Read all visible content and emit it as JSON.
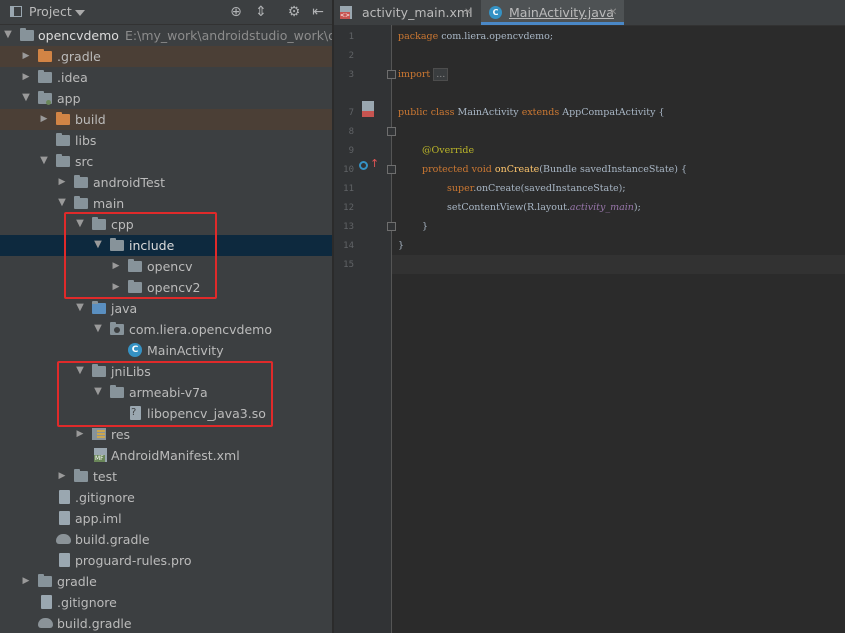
{
  "project_panel": {
    "title": "Project",
    "tree": [
      {
        "label": "opencvdemo",
        "extra": "E:\\my_work\\androidstudio_work\\op",
        "icon": "project-module-icon",
        "expanded": true
      },
      {
        "label": ".gradle",
        "icon": "folder-orange-icon",
        "expanded": false
      },
      {
        "label": ".idea",
        "icon": "folder-icon",
        "expanded": false
      },
      {
        "label": "app",
        "icon": "module-folder-icon",
        "expanded": true
      },
      {
        "label": "build",
        "icon": "folder-orange-icon",
        "expanded": false
      },
      {
        "label": "libs",
        "icon": "folder-icon"
      },
      {
        "label": "src",
        "icon": "folder-icon",
        "expanded": true
      },
      {
        "label": "androidTest",
        "icon": "folder-icon",
        "expanded": false
      },
      {
        "label": "main",
        "icon": "folder-icon",
        "expanded": true
      },
      {
        "label": "cpp",
        "icon": "folder-icon",
        "expanded": true
      },
      {
        "label": "include",
        "icon": "folder-icon",
        "expanded": true
      },
      {
        "label": "opencv",
        "icon": "folder-icon",
        "expanded": false
      },
      {
        "label": "opencv2",
        "icon": "folder-icon",
        "expanded": false
      },
      {
        "label": "java",
        "icon": "source-folder-icon",
        "expanded": true
      },
      {
        "label": "com.liera.opencvdemo",
        "icon": "package-icon",
        "expanded": true
      },
      {
        "label": "MainActivity",
        "icon": "class-icon"
      },
      {
        "label": "jniLibs",
        "icon": "folder-icon",
        "expanded": true
      },
      {
        "label": "armeabi-v7a",
        "icon": "folder-icon",
        "expanded": true
      },
      {
        "label": "libopencv_java3.so",
        "icon": "unknown-file-icon"
      },
      {
        "label": "res",
        "icon": "resource-folder-icon",
        "expanded": false
      },
      {
        "label": "AndroidManifest.xml",
        "icon": "manifest-icon"
      },
      {
        "label": "test",
        "icon": "folder-icon",
        "expanded": false
      },
      {
        "label": ".gitignore",
        "icon": "file-icon"
      },
      {
        "label": "app.iml",
        "icon": "file-icon"
      },
      {
        "label": "build.gradle",
        "icon": "gradle-icon"
      },
      {
        "label": "proguard-rules.pro",
        "icon": "file-icon"
      },
      {
        "label": "gradle",
        "icon": "folder-icon",
        "expanded": false
      },
      {
        "label": ".gitignore",
        "icon": "file-icon"
      },
      {
        "label": "build.gradle",
        "icon": "gradle-icon"
      }
    ]
  },
  "editor": {
    "tabs": [
      {
        "label": "activity_main.xml",
        "icon": "xml-file-icon",
        "active": false
      },
      {
        "label": "MainActivity.java",
        "icon": "class-icon",
        "active": true
      }
    ],
    "line_numbers": [
      "1",
      "2",
      "3",
      "7",
      "8",
      "9",
      "10",
      "11",
      "12",
      "13",
      "14",
      "15"
    ],
    "code": {
      "l1_kw": "package",
      "l1_rest": " com.liera.opencvdemo;",
      "l3_kw": "import",
      "l3_fold": "...",
      "l7_kw": "public class",
      "l7_name": " MainActivity ",
      "l7_ext": "extends",
      "l7_rest": " AppCompatActivity {",
      "l9_ann": "@Override",
      "l10_kw": "protected void",
      "l10_fn": " onCreate",
      "l10_rest": "(Bundle savedInstanceState) {",
      "l11_kw": "super",
      "l11_rest": ".onCreate(savedInstanceState);",
      "l12_pre": "setContentView(R.layout.",
      "l12_fld": "activity_main",
      "l12_post": ");",
      "l13": "}",
      "l14": "}"
    }
  },
  "colors": {
    "highlight_box": "#e02a2a",
    "selection": "#0d293e",
    "excluded": "#4b3f36",
    "keyword": "#cc7832",
    "annotation": "#bbb529",
    "method": "#ffc66d"
  }
}
